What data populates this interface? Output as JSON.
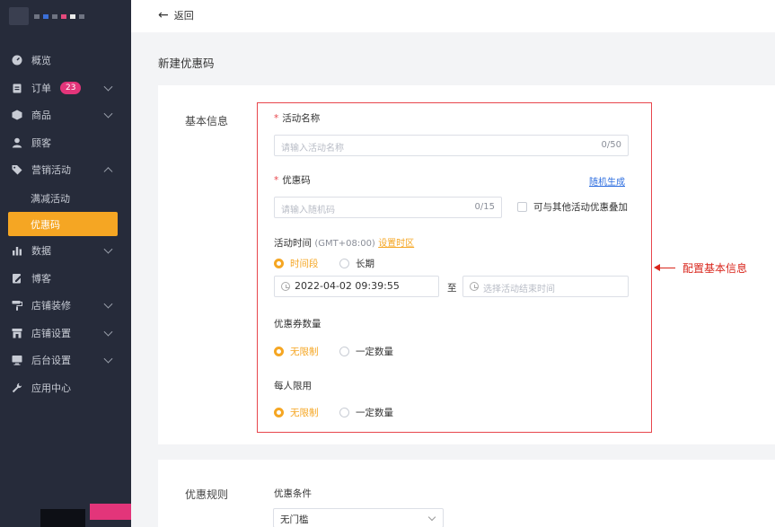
{
  "sidebar": {
    "items": [
      {
        "label": "概览",
        "icon": "dashboard-icon"
      },
      {
        "label": "订单",
        "icon": "clipboard-icon",
        "badge": "23",
        "chevron": "down"
      },
      {
        "label": "商品",
        "icon": "box-icon",
        "chevron": "down"
      },
      {
        "label": "顾客",
        "icon": "user-icon"
      },
      {
        "label": "营销活动",
        "icon": "tag-icon",
        "chevron": "up"
      },
      {
        "label": "数据",
        "icon": "bar-chart-icon",
        "chevron": "down"
      },
      {
        "label": "博客",
        "icon": "edit-icon"
      },
      {
        "label": "店铺装修",
        "icon": "paint-roller-icon",
        "chevron": "down"
      },
      {
        "label": "店铺设置",
        "icon": "store-icon",
        "chevron": "down"
      },
      {
        "label": "后台设置",
        "icon": "monitor-icon",
        "chevron": "down"
      },
      {
        "label": "应用中心",
        "icon": "wrench-icon"
      }
    ],
    "marketing_sub": [
      {
        "label": "满减活动"
      },
      {
        "label": "优惠码",
        "active": true
      }
    ]
  },
  "topbar": {
    "back_label": "返回"
  },
  "page": {
    "title": "新建优惠码"
  },
  "basic": {
    "section_label": "基本信息",
    "activity_name": {
      "label": "活动名称",
      "placeholder": "请输入活动名称",
      "counter": "0/50"
    },
    "coupon_code": {
      "label": "优惠码",
      "random_link": "随机生成",
      "placeholder": "请输入随机码",
      "counter": "0/15",
      "stack_label": "可与其他活动优惠叠加"
    },
    "activity_time": {
      "label": "活动时间",
      "timezone": "(GMT+08:00)",
      "set_tz_link": "设置时区",
      "options": [
        {
          "label": "时间段",
          "checked": true
        },
        {
          "label": "长期",
          "checked": false
        }
      ],
      "start_value": "2022-04-02 09:39:55",
      "to_label": "至",
      "end_placeholder": "选择活动结束时间"
    },
    "coupon_count": {
      "label": "优惠券数量",
      "options": [
        {
          "label": "无限制",
          "checked": true
        },
        {
          "label": "一定数量",
          "checked": false
        }
      ]
    },
    "per_user": {
      "label": "每人限用",
      "options": [
        {
          "label": "无限制",
          "checked": true
        },
        {
          "label": "一定数量",
          "checked": false
        }
      ]
    }
  },
  "annotation": {
    "text": "配置基本信息"
  },
  "rules": {
    "section_label": "优惠规则",
    "condition_label": "优惠条件",
    "condition_value": "无门槛"
  },
  "colors": {
    "accent": "#f5a623",
    "sidebar_bg": "#262b3a",
    "badge": "#e3357a",
    "annotation": "#d9261c",
    "link": "#2f6fe0"
  }
}
